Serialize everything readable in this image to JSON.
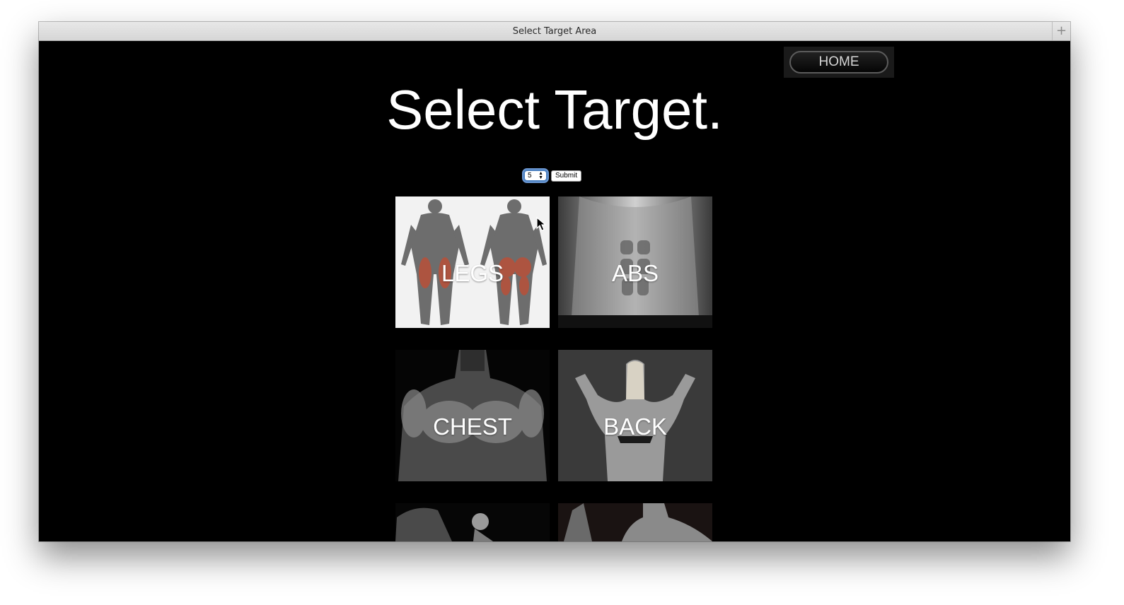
{
  "window": {
    "title": "Select Target Area",
    "new_tab_symbol": "+"
  },
  "nav": {
    "home_label": "HOME"
  },
  "page": {
    "title": "Select Target."
  },
  "form": {
    "select_value": "5",
    "submit_label": "Submit"
  },
  "targets": [
    {
      "label": "LEGS"
    },
    {
      "label": "ABS"
    },
    {
      "label": "CHEST"
    },
    {
      "label": "BACK"
    },
    {
      "label": ""
    },
    {
      "label": ""
    }
  ]
}
